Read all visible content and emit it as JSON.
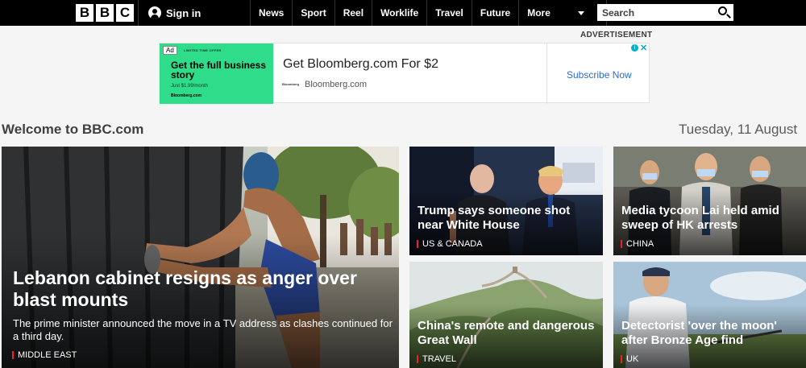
{
  "header": {
    "logo_letters": [
      "B",
      "B",
      "C"
    ],
    "sign_in_label": "Sign in",
    "nav": [
      "News",
      "Sport",
      "Reel",
      "Worklife",
      "Travel",
      "Future",
      "More"
    ],
    "search_placeholder": "Search"
  },
  "advertisement": {
    "label": "ADVERTISEMENT",
    "badge": "Ad",
    "offer_line": "LIMITED TIME OFFER",
    "creative_headline": "Get the full business story",
    "creative_small": "Just $1.99/month",
    "creative_brand": "Bloomberg.com",
    "title": "Get Bloomberg.com For $2",
    "brand_mini": "Bloomberg",
    "url_text": "Bloomberg.com",
    "cta": "Subscribe Now",
    "choices_icon": "i",
    "close_icon": "✕"
  },
  "welcome": {
    "title": "Welcome to BBC.com",
    "date": "Tuesday, 11 August"
  },
  "stories": [
    {
      "headline": "Lebanon cabinet resigns as anger over blast mounts",
      "summary": "The prime minister announced the move in a TV address as clashes continued for a third day.",
      "tag": "MIDDLE EAST"
    },
    {
      "headline": "Trump says someone shot near White House",
      "tag": "US & CANADA"
    },
    {
      "headline": "Media tycoon Lai held amid sweep of HK arrests",
      "tag": "CHINA"
    },
    {
      "headline": "China's remote and dangerous Great Wall",
      "tag": "TRAVEL"
    },
    {
      "headline": "Detectorist 'over the moon' after Bronze Age find",
      "tag": "UK"
    }
  ],
  "colors": {
    "nav_bg": "#000000",
    "tag_accent": "#ee2222",
    "ad_green": "#2edc8a",
    "cta_blue": "#2b6bd3"
  }
}
